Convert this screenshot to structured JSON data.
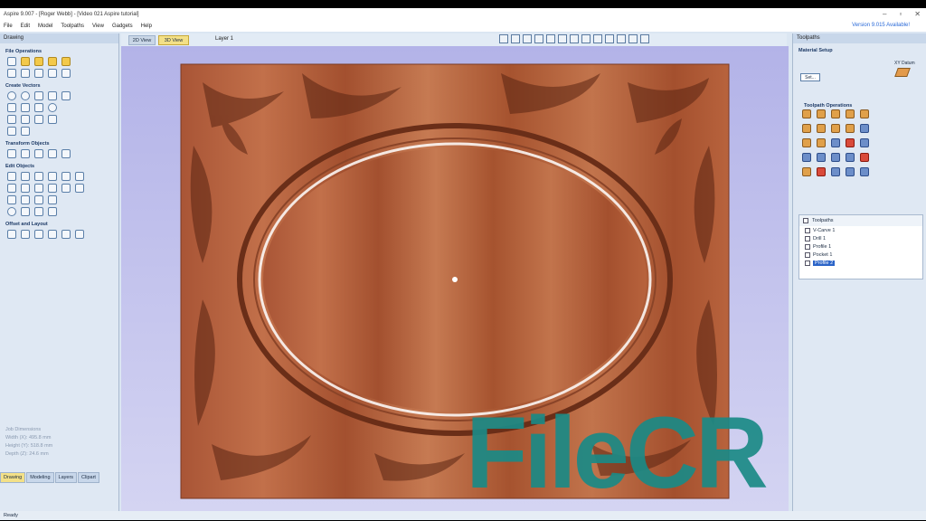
{
  "window": {
    "title": "Aspire 9.007 - [Roger Webb] - [Video 021 Aspire tutorial]",
    "version_notice": "Version 9.015 Available!"
  },
  "menu": [
    "File",
    "Edit",
    "Model",
    "Toolpaths",
    "View",
    "Gadgets",
    "Help"
  ],
  "view_tabs": {
    "tab_2d": "2D View",
    "tab_3d": "3D View"
  },
  "layer": "Layer 1",
  "left_panel": {
    "header": "Drawing",
    "sections": [
      "File Operations",
      "Create Vectors",
      "Transform Objects",
      "Edit Objects",
      "Offset and Layout"
    ],
    "job_dimensions": {
      "title": "Job Dimensions",
      "width": "Width (X): 495.8 mm",
      "height": "Height (Y): 518.8 mm",
      "depth": "Depth (Z): 24.6 mm"
    },
    "tabs": [
      "Drawing",
      "Modeling",
      "Layers",
      "Clipart"
    ]
  },
  "right_panel": {
    "header": "Toolpaths",
    "material_setup": "Material Setup",
    "set_button": "Set...",
    "xy_datum": "XY Datum",
    "toolpath_operations": "Toolpath Operations",
    "toolpaths_header": "Toolpaths",
    "toolpaths": [
      {
        "name": "V-Carve 1",
        "selected": false
      },
      {
        "name": "Drill 1",
        "selected": false
      },
      {
        "name": "Profile 1",
        "selected": false
      },
      {
        "name": "Pocket 1",
        "selected": false
      },
      {
        "name": "Profile 2",
        "selected": true
      }
    ]
  },
  "status": "Ready",
  "watermark": "FileCR",
  "colors": {
    "wood": "#b5603a",
    "accent": "#f3e087",
    "watermark": "#1b8a86"
  }
}
